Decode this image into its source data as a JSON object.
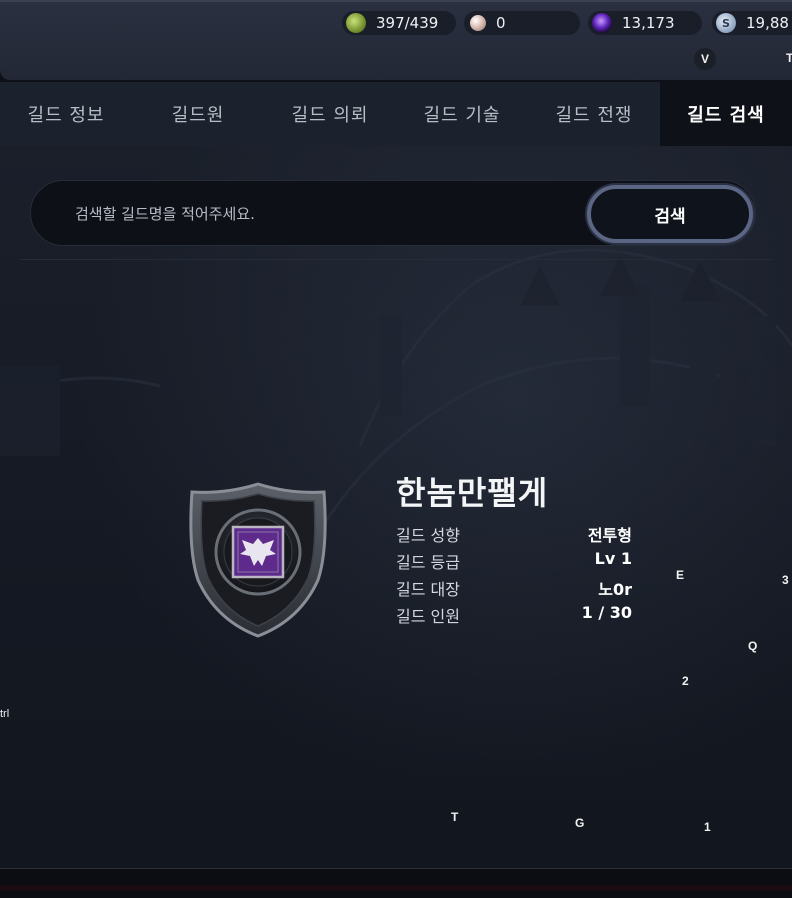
{
  "resources": [
    {
      "icon": "energy-icon",
      "value": "397/439"
    },
    {
      "icon": "pearl-icon",
      "value": "0"
    },
    {
      "icon": "gem-icon",
      "value": "13,173"
    },
    {
      "icon": "silver-coin-icon",
      "value": "19,88",
      "glyph": "S"
    }
  ],
  "key_hints": {
    "v": "V",
    "t_top": "T",
    "e": "E",
    "three": "3",
    "q": "Q",
    "two": "2",
    "ctrl": "trl",
    "t_bottom": "T",
    "g": "G",
    "one": "1"
  },
  "tabs": [
    {
      "label": "길드 정보",
      "active": false
    },
    {
      "label": "길드원",
      "active": false
    },
    {
      "label": "길드 의뢰",
      "active": false
    },
    {
      "label": "길드 기술",
      "active": false
    },
    {
      "label": "길드 전쟁",
      "active": false
    },
    {
      "label": "길드 검색",
      "active": true
    }
  ],
  "search": {
    "placeholder": "검색할 길드명을 적어주세요.",
    "button_label": "검색"
  },
  "guild": {
    "name": "한놈만팰게",
    "emblem_icon": "phoenix-emblem-icon",
    "info": [
      {
        "label": "길드 성향",
        "value": "전투형"
      },
      {
        "label": "길드 등급",
        "value": "Lv 1"
      },
      {
        "label": "길드 대장",
        "value": "노0r"
      },
      {
        "label": "길드 인원",
        "value": "1 / 30"
      }
    ]
  },
  "colors": {
    "background": "#151923",
    "tab_bar": "#1c222d",
    "active_tab": "#0e1117",
    "search_button_border": "#5b6584",
    "emblem_purple": "#5e2a8c"
  }
}
